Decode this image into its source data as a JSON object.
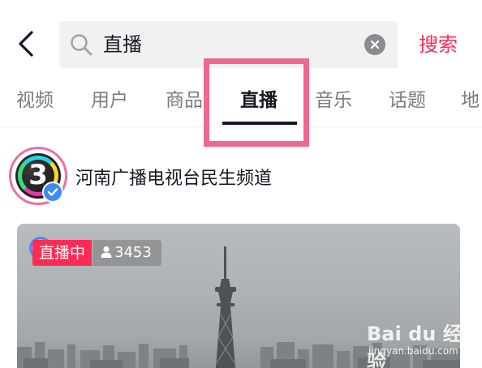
{
  "search": {
    "query": "直播",
    "submit_label": "搜索"
  },
  "tabs": [
    {
      "label": "视频"
    },
    {
      "label": "用户"
    },
    {
      "label": "商品"
    },
    {
      "label": "直播"
    },
    {
      "label": "音乐"
    },
    {
      "label": "话题"
    },
    {
      "label": "地"
    }
  ],
  "active_tab": "直播",
  "channel": {
    "avatar_text": "3",
    "name": "河南广播电视台民生频道"
  },
  "live_card": {
    "status_label": "直播中",
    "viewer_count": "3453"
  },
  "watermark": {
    "logo": "Bai du 经验",
    "url": "jingyan.baidu.com"
  },
  "colors": {
    "accent": "#fe2c55",
    "highlight_box": "#f0678e",
    "verified": "#3b8df4",
    "text_primary": "#161823",
    "text_secondary": "#7b7c83"
  },
  "icons": {
    "back": "chevron-left-icon",
    "search": "search-icon",
    "clear": "close-circle-icon",
    "verified": "verified-check-icon",
    "viewer": "person-icon"
  }
}
